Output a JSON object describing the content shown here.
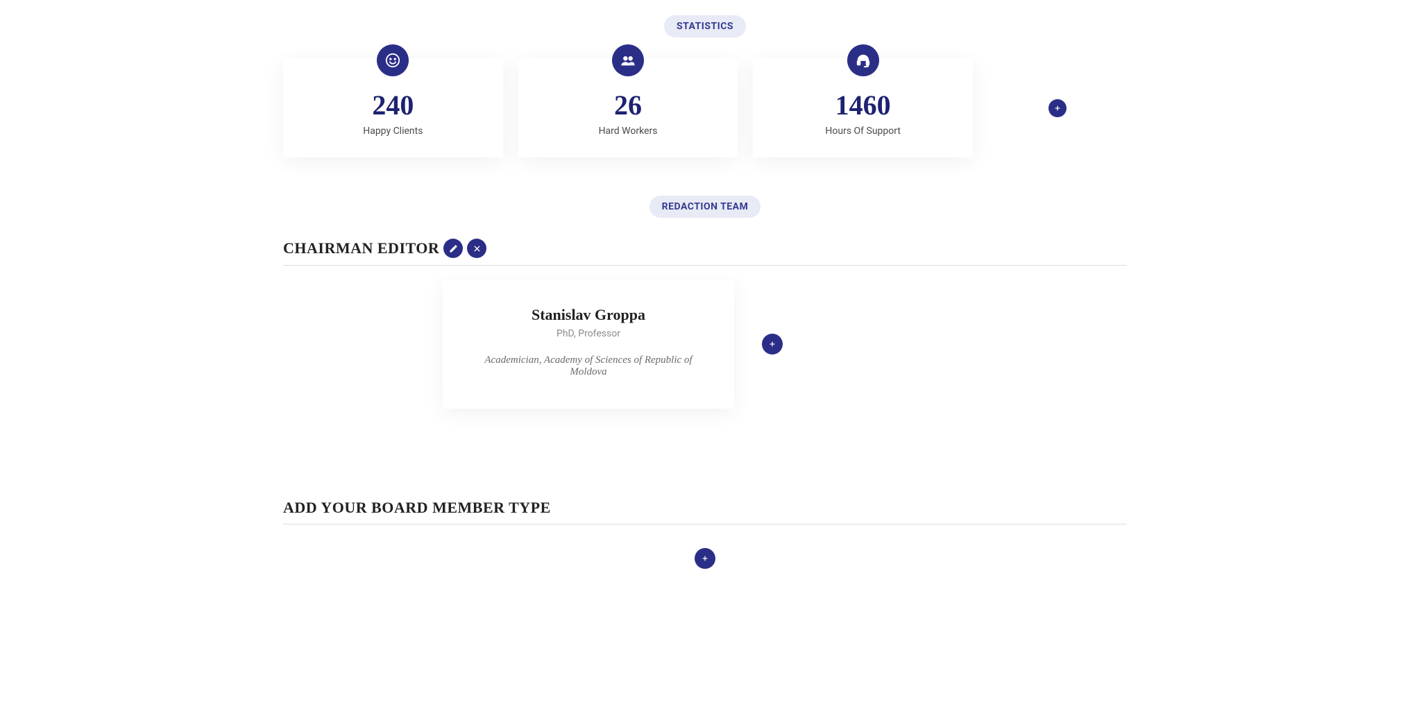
{
  "badges": {
    "statistics": "STATISTICS",
    "redaction_team": "REDACTION TEAM"
  },
  "stats": [
    {
      "icon": "smile",
      "value": "240",
      "label": "Happy Clients"
    },
    {
      "icon": "people",
      "value": "26",
      "label": "Hard Workers"
    },
    {
      "icon": "headset",
      "value": "1460",
      "label": "Hours Of Support"
    }
  ],
  "team": {
    "heading": "CHAIRMAN EDITOR",
    "member": {
      "name": "Stanislav Groppa",
      "subtitle": "PhD, Professor",
      "description": "Academician, Academy of Sciences of Republic of Moldova"
    }
  },
  "board": {
    "heading": "ADD YOUR BOARD MEMBER TYPE"
  },
  "colors": {
    "accent": "#2b2e87",
    "badge_bg": "#e8eaf6"
  }
}
